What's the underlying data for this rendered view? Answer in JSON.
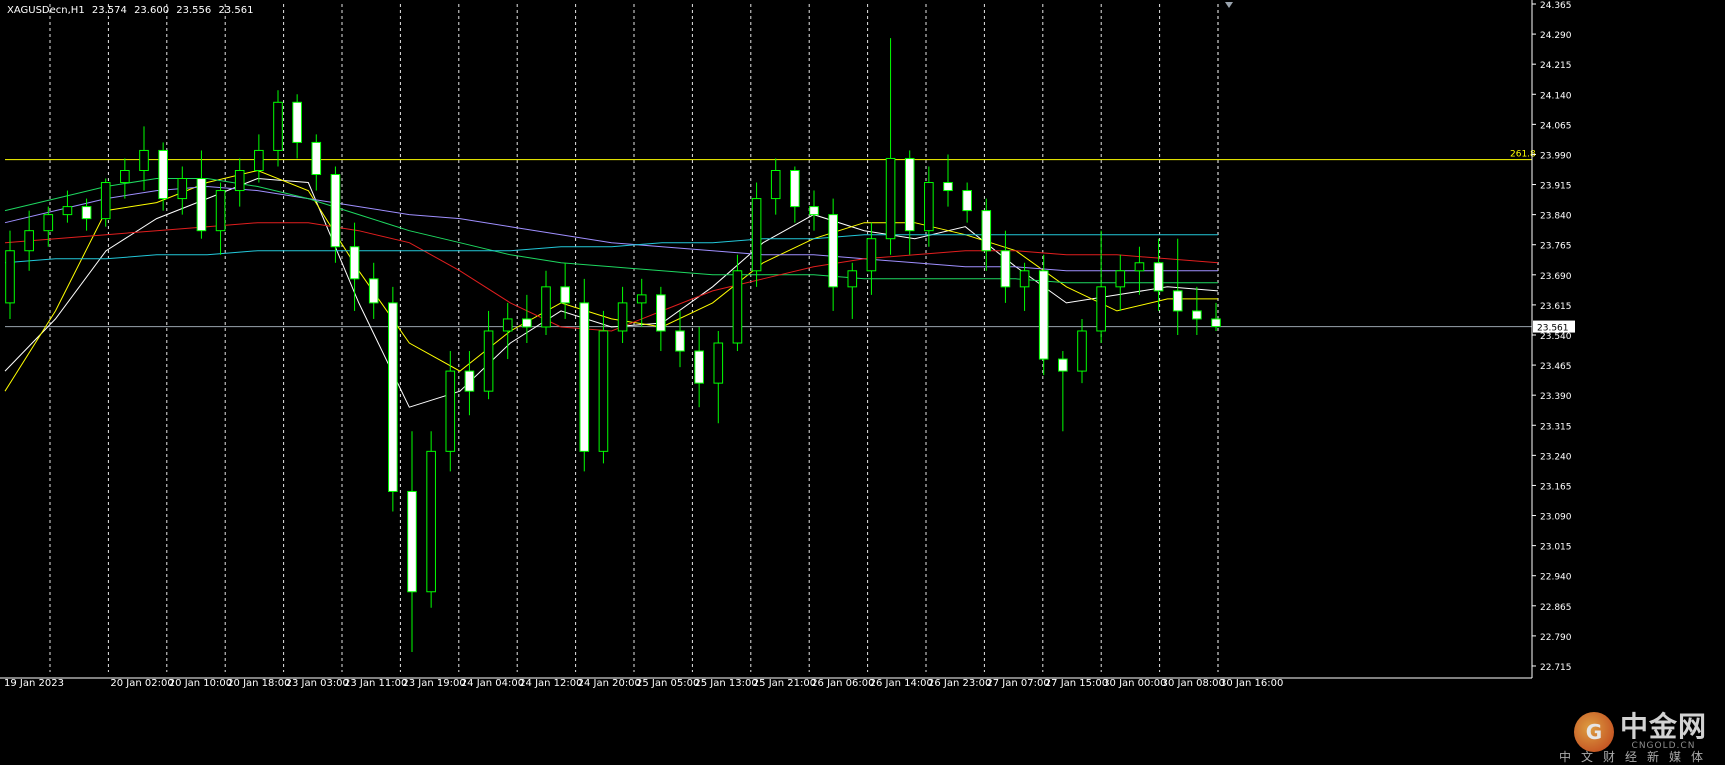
{
  "header": {
    "symbol": "XAGUSDecn,H1",
    "open": "23.574",
    "high": "23.600",
    "low": "23.556",
    "close": "23.561"
  },
  "fib_label": "261.8",
  "current_price_label": "23.561",
  "watermark": {
    "brand": "中金网",
    "url": "CNGOLD.CN",
    "subtitle": "中文财经新媒体"
  },
  "colors": {
    "background": "#000000",
    "candle": "#00ff00",
    "candle_body_bull": "#000000",
    "candle_body_bear": "#ffffff",
    "grid": "#ffffff",
    "fib_line": "#ffff00",
    "price_line": "#9aa4ae",
    "axis_text": "#ffffff"
  },
  "chart_data": {
    "type": "candlestick",
    "timeframe": "H1",
    "ylim": [
      22.7,
      24.365
    ],
    "y_ticks": [
      "24.365",
      "24.290",
      "24.215",
      "24.140",
      "24.065",
      "23.990",
      "23.915",
      "23.840",
      "23.765",
      "23.690",
      "23.615",
      "23.540",
      "23.465",
      "23.390",
      "23.315",
      "23.240",
      "23.165",
      "23.090",
      "23.015",
      "22.940",
      "22.865",
      "22.790",
      "22.715"
    ],
    "x_labels": [
      "19 Jan 2023",
      "20 Jan 02:00",
      "20 Jan 10:00",
      "20 Jan 18:00",
      "23 Jan 03:00",
      "23 Jan 11:00",
      "23 Jan 19:00",
      "24 Jan 04:00",
      "24 Jan 12:00",
      "24 Jan 20:00",
      "25 Jan 05:00",
      "25 Jan 13:00",
      "25 Jan 21:00",
      "26 Jan 06:00",
      "26 Jan 14:00",
      "26 Jan 23:00",
      "27 Jan 07:00",
      "27 Jan 15:00",
      "30 Jan 00:00",
      "30 Jan 08:00",
      "30 Jan 16:00"
    ],
    "horizontal_levels": [
      {
        "label": "261.8",
        "value": 23.977,
        "style": "fib"
      },
      {
        "label": "23.561",
        "value": 23.561,
        "style": "bid"
      }
    ],
    "moving_averages": [
      {
        "color": "#ffffff",
        "values": [
          23.45,
          23.58,
          23.75,
          23.83,
          23.88,
          23.93,
          23.92,
          23.62,
          23.36,
          23.4,
          23.52,
          23.6,
          23.56,
          23.57,
          23.66,
          23.77,
          23.84,
          23.8,
          23.78,
          23.81,
          23.71,
          23.62,
          23.64,
          23.66,
          23.65
        ]
      },
      {
        "color": "#ffff00",
        "values": [
          23.4,
          23.6,
          23.85,
          23.87,
          23.92,
          23.95,
          23.9,
          23.7,
          23.52,
          23.45,
          23.55,
          23.62,
          23.58,
          23.56,
          23.62,
          23.72,
          23.78,
          23.82,
          23.82,
          23.79,
          23.75,
          23.66,
          23.6,
          23.63,
          23.63
        ]
      },
      {
        "color": "#9f8fff",
        "values": [
          23.82,
          23.85,
          23.88,
          23.9,
          23.91,
          23.9,
          23.88,
          23.86,
          23.84,
          23.83,
          23.81,
          23.79,
          23.77,
          23.76,
          23.75,
          23.74,
          23.74,
          23.73,
          23.72,
          23.71,
          23.71,
          23.7,
          23.7,
          23.7,
          23.7
        ]
      },
      {
        "color": "#1ed760",
        "values": [
          23.85,
          23.88,
          23.91,
          23.93,
          23.93,
          23.91,
          23.88,
          23.84,
          23.8,
          23.77,
          23.74,
          23.72,
          23.71,
          23.7,
          23.69,
          23.69,
          23.69,
          23.68,
          23.68,
          23.68,
          23.68,
          23.67,
          23.67,
          23.67,
          23.67
        ]
      },
      {
        "color": "#e01e1e",
        "values": [
          23.77,
          23.78,
          23.79,
          23.8,
          23.81,
          23.82,
          23.82,
          23.8,
          23.77,
          23.7,
          23.62,
          23.56,
          23.55,
          23.6,
          23.65,
          23.68,
          23.71,
          23.73,
          23.74,
          23.75,
          23.75,
          23.74,
          23.74,
          23.73,
          23.72
        ]
      },
      {
        "color": "#22c7d9",
        "values": [
          23.72,
          23.73,
          23.73,
          23.74,
          23.74,
          23.75,
          23.75,
          23.75,
          23.75,
          23.75,
          23.75,
          23.76,
          23.76,
          23.77,
          23.77,
          23.78,
          23.78,
          23.79,
          23.79,
          23.79,
          23.79,
          23.79,
          23.79,
          23.79,
          23.79
        ]
      }
    ],
    "candles": [
      [
        23.62,
        23.8,
        23.58,
        23.75
      ],
      [
        23.75,
        23.85,
        23.7,
        23.8
      ],
      [
        23.8,
        23.86,
        23.76,
        23.84
      ],
      [
        23.84,
        23.9,
        23.82,
        23.86
      ],
      [
        23.86,
        23.88,
        23.8,
        23.83
      ],
      [
        23.83,
        23.93,
        23.81,
        23.92
      ],
      [
        23.92,
        23.98,
        23.88,
        23.95
      ],
      [
        23.95,
        24.06,
        23.9,
        24.0
      ],
      [
        24.0,
        24.02,
        23.85,
        23.88
      ],
      [
        23.88,
        23.96,
        23.84,
        23.93
      ],
      [
        23.93,
        24.0,
        23.78,
        23.8
      ],
      [
        23.8,
        23.92,
        23.74,
        23.9
      ],
      [
        23.9,
        23.98,
        23.86,
        23.95
      ],
      [
        23.95,
        24.04,
        23.92,
        24.0
      ],
      [
        24.0,
        24.15,
        23.96,
        24.12
      ],
      [
        24.12,
        24.14,
        23.98,
        24.02
      ],
      [
        24.02,
        24.04,
        23.9,
        23.94
      ],
      [
        23.94,
        23.96,
        23.72,
        23.76
      ],
      [
        23.76,
        23.82,
        23.6,
        23.68
      ],
      [
        23.68,
        23.72,
        23.58,
        23.62
      ],
      [
        23.62,
        23.66,
        23.1,
        23.15
      ],
      [
        23.15,
        23.3,
        22.75,
        22.9
      ],
      [
        22.9,
        23.3,
        22.86,
        23.25
      ],
      [
        23.25,
        23.5,
        23.2,
        23.45
      ],
      [
        23.45,
        23.5,
        23.34,
        23.4
      ],
      [
        23.4,
        23.6,
        23.38,
        23.55
      ],
      [
        23.55,
        23.62,
        23.48,
        23.58
      ],
      [
        23.58,
        23.64,
        23.52,
        23.56
      ],
      [
        23.56,
        23.7,
        23.54,
        23.66
      ],
      [
        23.66,
        23.72,
        23.58,
        23.62
      ],
      [
        23.62,
        23.68,
        23.2,
        23.25
      ],
      [
        23.25,
        23.6,
        23.22,
        23.55
      ],
      [
        23.55,
        23.66,
        23.52,
        23.62
      ],
      [
        23.62,
        23.68,
        23.56,
        23.64
      ],
      [
        23.64,
        23.66,
        23.5,
        23.55
      ],
      [
        23.55,
        23.6,
        23.46,
        23.5
      ],
      [
        23.5,
        23.56,
        23.36,
        23.42
      ],
      [
        23.42,
        23.55,
        23.32,
        23.52
      ],
      [
        23.52,
        23.74,
        23.5,
        23.7
      ],
      [
        23.7,
        23.92,
        23.66,
        23.88
      ],
      [
        23.88,
        23.98,
        23.84,
        23.95
      ],
      [
        23.95,
        23.96,
        23.82,
        23.86
      ],
      [
        23.86,
        23.9,
        23.8,
        23.84
      ],
      [
        23.84,
        23.88,
        23.6,
        23.66
      ],
      [
        23.66,
        23.72,
        23.58,
        23.7
      ],
      [
        23.7,
        23.82,
        23.64,
        23.78
      ],
      [
        23.78,
        24.28,
        23.74,
        23.98
      ],
      [
        23.98,
        24.0,
        23.74,
        23.8
      ],
      [
        23.8,
        23.96,
        23.76,
        23.92
      ],
      [
        23.92,
        23.99,
        23.86,
        23.9
      ],
      [
        23.9,
        23.92,
        23.82,
        23.85
      ],
      [
        23.85,
        23.88,
        23.7,
        23.75
      ],
      [
        23.75,
        23.8,
        23.62,
        23.66
      ],
      [
        23.66,
        23.72,
        23.6,
        23.7
      ],
      [
        23.7,
        23.74,
        23.44,
        23.48
      ],
      [
        23.48,
        23.5,
        23.3,
        23.45
      ],
      [
        23.45,
        23.58,
        23.42,
        23.55
      ],
      [
        23.55,
        23.8,
        23.52,
        23.66
      ],
      [
        23.66,
        23.74,
        23.6,
        23.7
      ],
      [
        23.7,
        23.76,
        23.64,
        23.72
      ],
      [
        23.72,
        23.78,
        23.6,
        23.65
      ],
      [
        23.65,
        23.78,
        23.54,
        23.6
      ],
      [
        23.6,
        23.66,
        23.54,
        23.58
      ],
      [
        23.58,
        23.62,
        23.55,
        23.561
      ]
    ]
  }
}
